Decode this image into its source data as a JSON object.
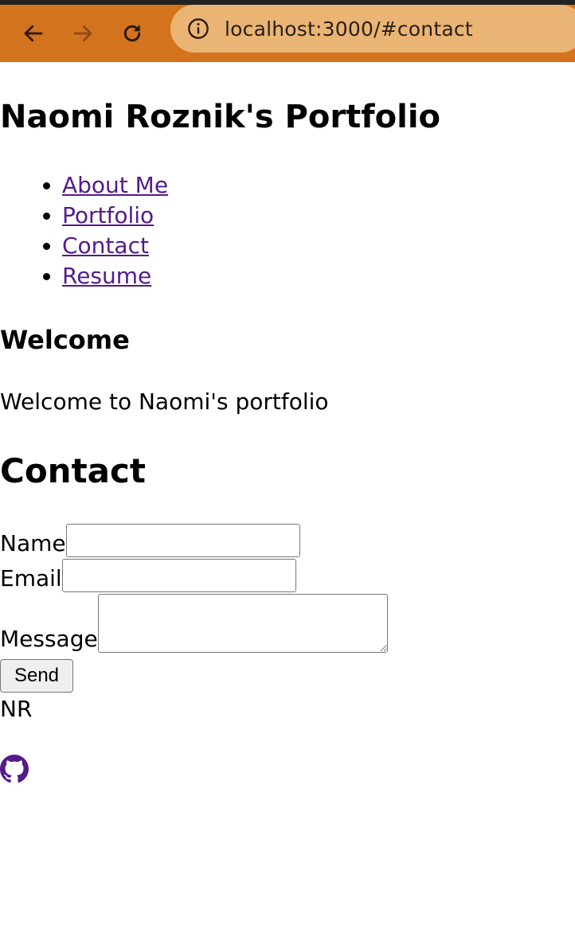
{
  "browser": {
    "url": "localhost:3000/#contact",
    "back_icon": "arrow-left-icon",
    "forward_icon": "arrow-right-icon",
    "reload_icon": "reload-icon",
    "site_info_icon": "info-circle-icon",
    "toolbar_color": "#d4731e",
    "urlbar_color": "#eab474"
  },
  "header": {
    "title": "Naomi Roznik's Portfolio"
  },
  "nav": {
    "items": [
      {
        "label": "About Me"
      },
      {
        "label": "Portfolio"
      },
      {
        "label": "Contact"
      },
      {
        "label": "Resume"
      }
    ],
    "link_color": "#551a8b"
  },
  "welcome": {
    "heading": "Welcome",
    "text": "Welcome to Naomi's portfolio"
  },
  "contact": {
    "heading": "Contact",
    "name_label": "Name",
    "name_value": "",
    "email_label": "Email",
    "email_value": "",
    "message_label": "Message",
    "message_value": "",
    "send_label": "Send"
  },
  "footer": {
    "initials": "NR",
    "github_icon": "github-icon"
  }
}
